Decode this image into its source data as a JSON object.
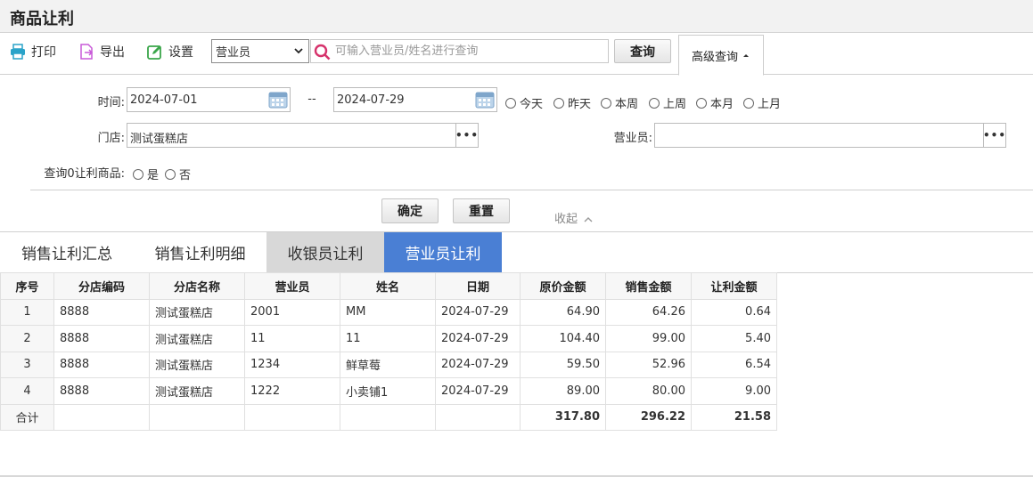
{
  "page_title": "商品让利",
  "toolbar": {
    "print_label": "打印",
    "export_label": "导出",
    "settings_label": "设置",
    "select_value": "营业员",
    "search_placeholder": "可输入营业员/姓名进行查询",
    "query_label": "查询",
    "advanced_label": "高级查询"
  },
  "filter": {
    "time_label": "时间:",
    "date_from": "2024-07-01",
    "date_sep": "--",
    "date_to": "2024-07-29",
    "quick": [
      "今天",
      "昨天",
      "本周",
      "上周",
      "本月",
      "上月"
    ],
    "store_label": "门店:",
    "store_value": "测试蛋糕店",
    "clerk_label": "营业员:",
    "clerk_value": "",
    "zero_label": "查询0让利商品:",
    "yes_label": "是",
    "no_label": "否",
    "confirm_label": "确定",
    "reset_label": "重置",
    "collapse_label": "收起"
  },
  "tabs": [
    {
      "label": "销售让利汇总",
      "state": "normal"
    },
    {
      "label": "销售让利明细",
      "state": "normal"
    },
    {
      "label": "收银员让利",
      "state": "gray"
    },
    {
      "label": "营业员让利",
      "state": "active"
    }
  ],
  "colors": {
    "active_tab": "#4a7fd4",
    "gray_tab": "#d8d8d8",
    "search_icon": "#d6336c"
  },
  "table": {
    "headers": [
      "序号",
      "分店编码",
      "分店名称",
      "营业员",
      "姓名",
      "日期",
      "原价金额",
      "销售金额",
      "让利金额"
    ],
    "rows": [
      [
        "1",
        "8888",
        "测试蛋糕店",
        "2001",
        "MM",
        "2024-07-29",
        "64.90",
        "64.26",
        "0.64"
      ],
      [
        "2",
        "8888",
        "测试蛋糕店",
        "11",
        "11",
        "2024-07-29",
        "104.40",
        "99.00",
        "5.40"
      ],
      [
        "3",
        "8888",
        "测试蛋糕店",
        "1234",
        "鲜草莓",
        "2024-07-29",
        "59.50",
        "52.96",
        "6.54"
      ],
      [
        "4",
        "8888",
        "测试蛋糕店",
        "1222",
        "小卖铺1",
        "2024-07-29",
        "89.00",
        "80.00",
        "9.00"
      ]
    ],
    "total_label": "合计",
    "totals": [
      "317.80",
      "296.22",
      "21.58"
    ]
  }
}
